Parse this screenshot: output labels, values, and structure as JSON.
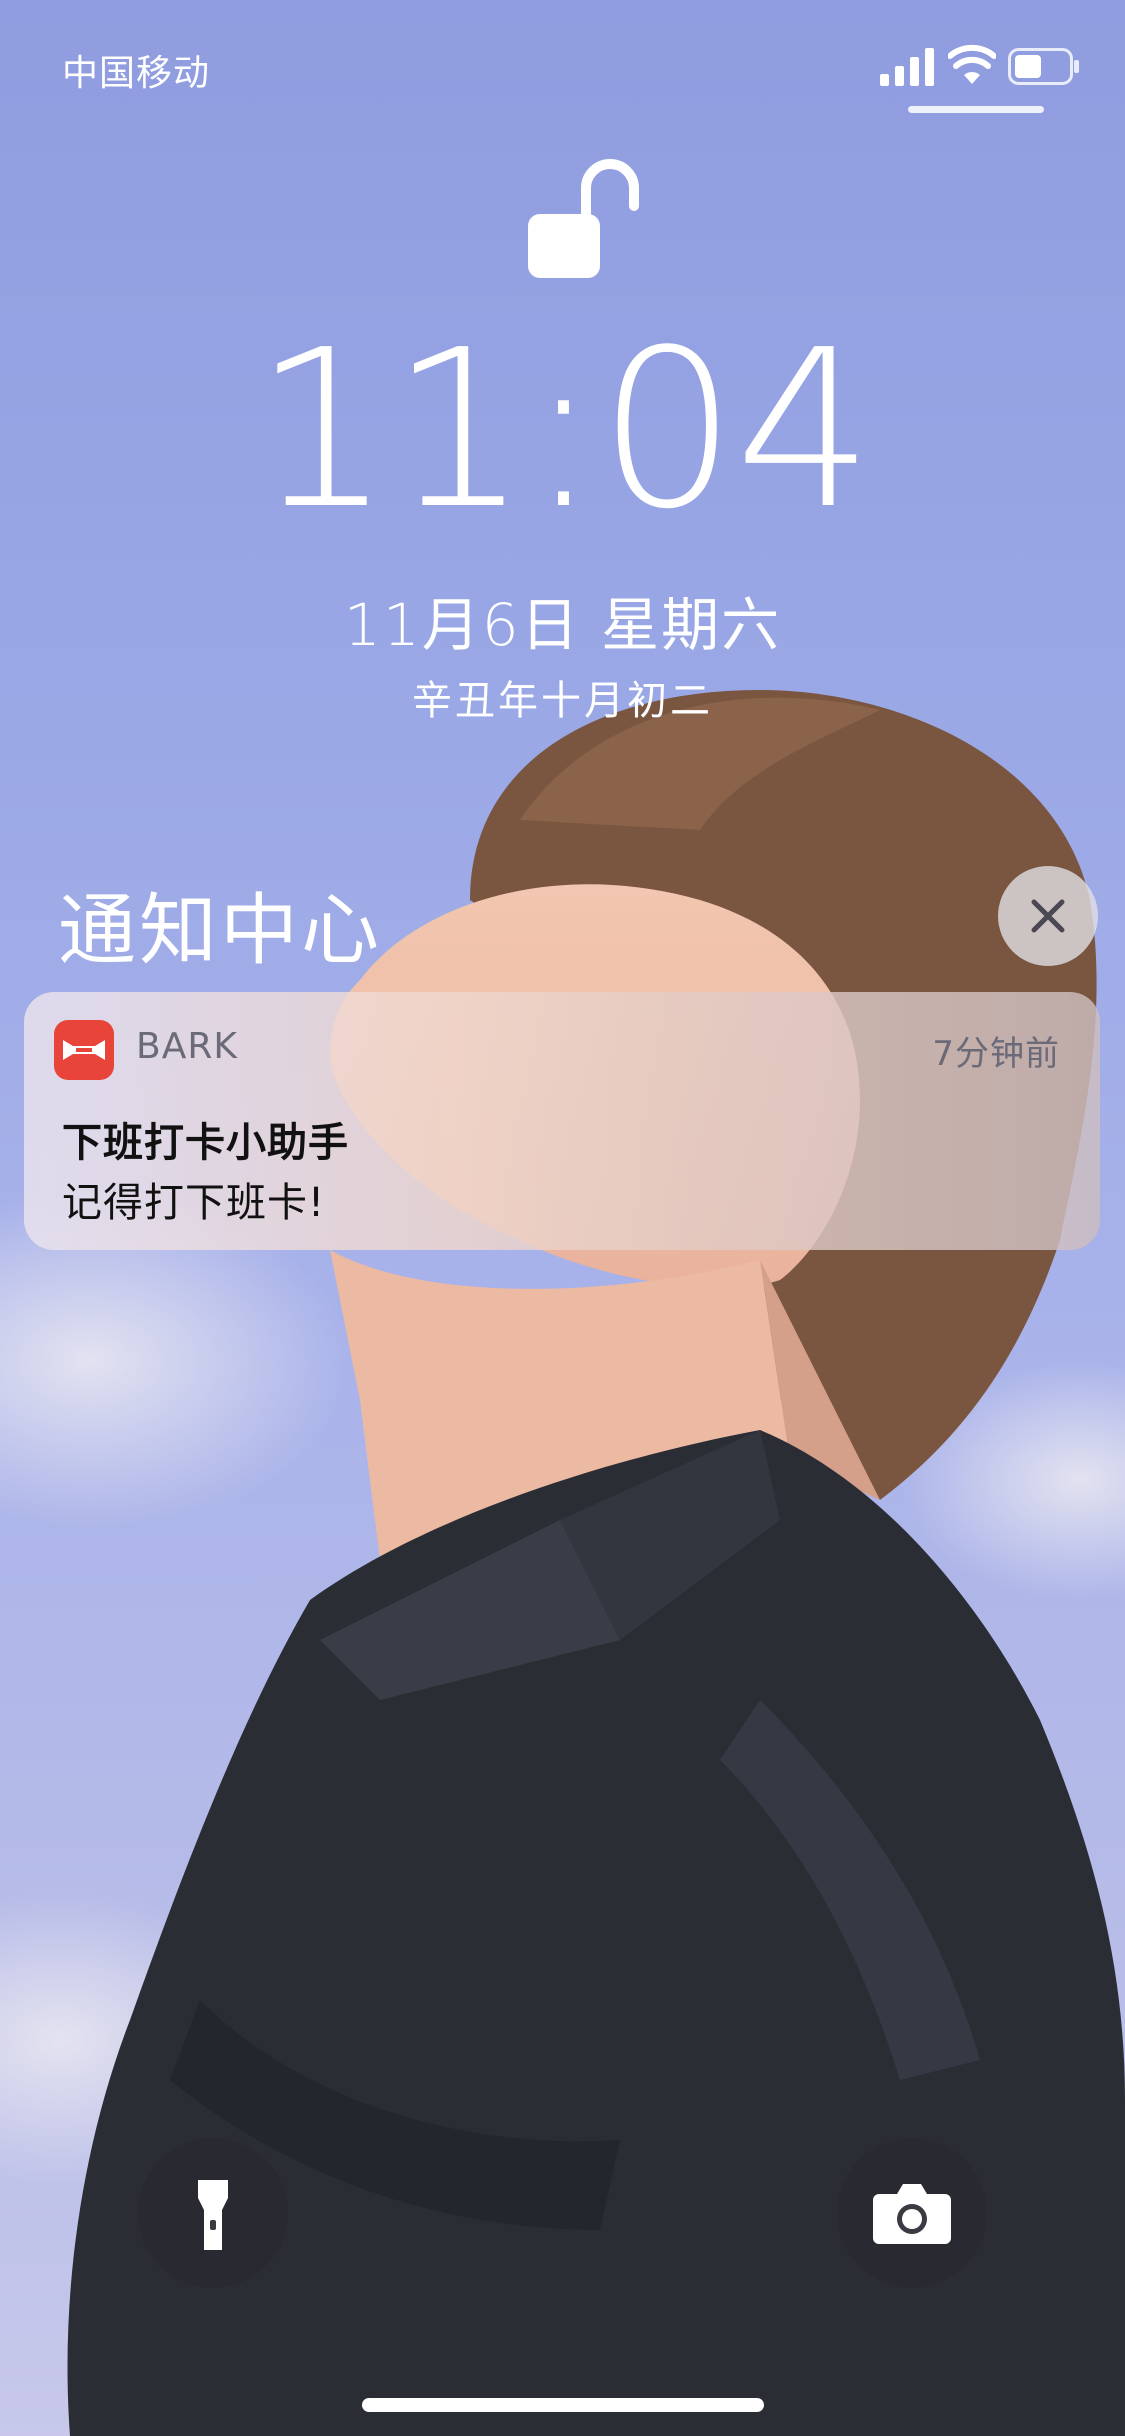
{
  "status_bar": {
    "carrier": "中国移动",
    "icons": [
      "signal-icon",
      "wifi-icon",
      "battery-icon"
    ]
  },
  "lock_screen": {
    "lock_icon": "unlocked-padlock-icon",
    "time": "11:04",
    "date": "11月6日 星期六",
    "lunar_date": "辛丑年十月初二"
  },
  "notification_center": {
    "title": "通知中心",
    "clear_icon": "close-icon",
    "notifications": [
      {
        "app_name": "BARK",
        "app_icon": "bark-app-icon",
        "time": "7分钟前",
        "title": "下班打卡小助手",
        "body": "记得打下班卡!"
      }
    ]
  },
  "quick_actions": {
    "left": "flashlight-icon",
    "right": "camera-icon"
  },
  "colors": {
    "app_icon_bg": "#e8443a",
    "sky": "#9aa8e6",
    "shirt": "#2b2d35"
  }
}
